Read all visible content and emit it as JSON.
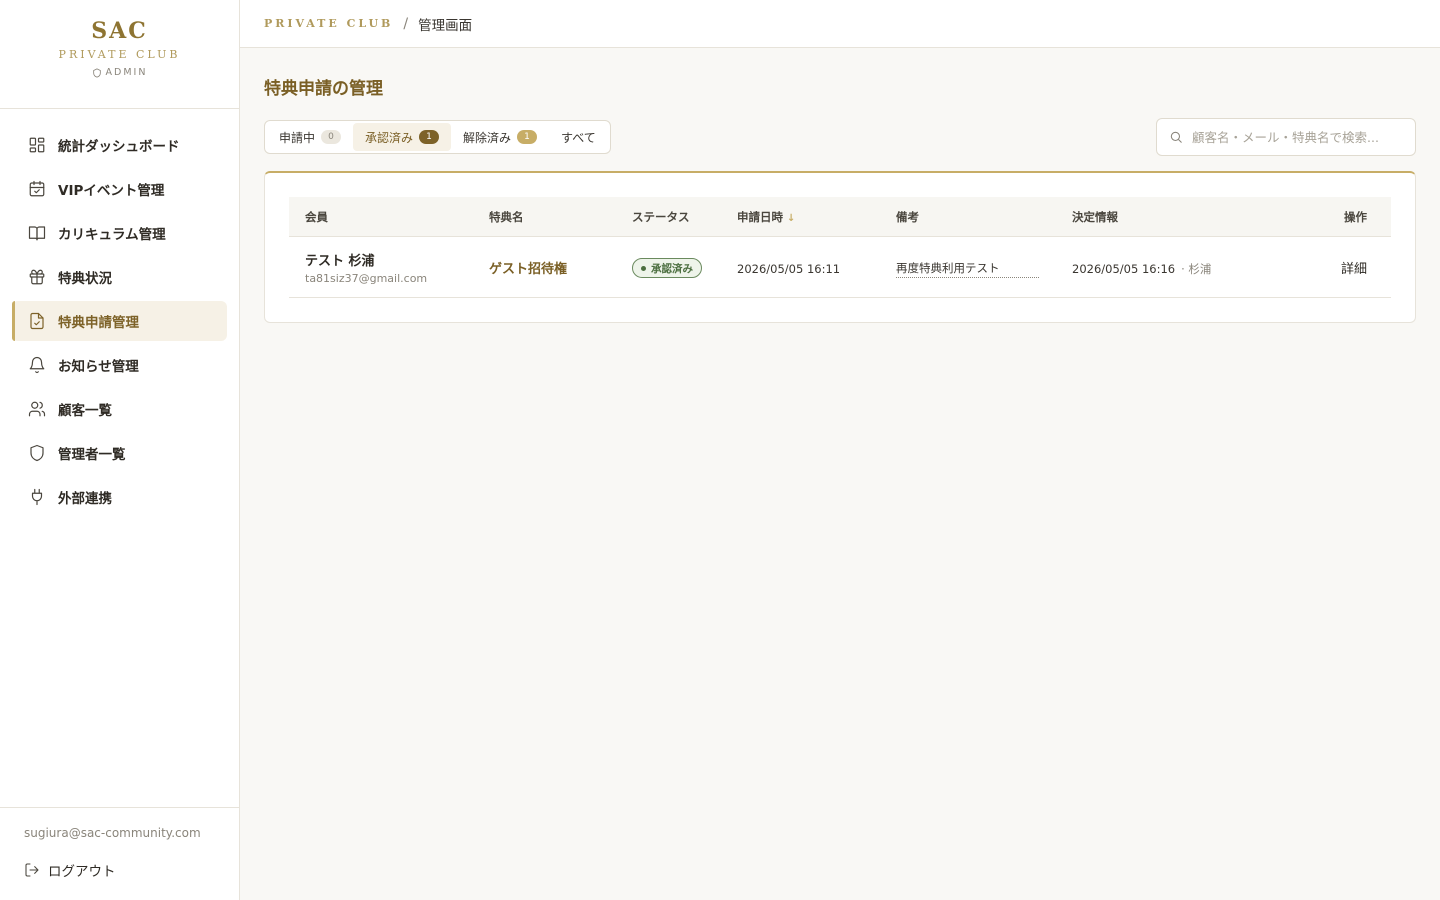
{
  "brand": {
    "name": "SAC",
    "sub": "PRIVATE CLUB",
    "role": "ADMIN"
  },
  "sidebar": {
    "items": [
      {
        "label": "統計ダッシュボード",
        "icon": "dashboard-icon"
      },
      {
        "label": "VIPイベント管理",
        "icon": "calendar-icon"
      },
      {
        "label": "カリキュラム管理",
        "icon": "book-icon"
      },
      {
        "label": "特典状況",
        "icon": "gift-icon"
      },
      {
        "label": "特典申請管理",
        "icon": "file-check-icon",
        "active": true
      },
      {
        "label": "お知らせ管理",
        "icon": "bell-icon"
      },
      {
        "label": "顧客一覧",
        "icon": "users-icon"
      },
      {
        "label": "管理者一覧",
        "icon": "shield-icon"
      },
      {
        "label": "外部連携",
        "icon": "plug-icon"
      }
    ],
    "user_email": "sugiura@sac-community.com",
    "logout_label": "ログアウト"
  },
  "header": {
    "club": "PRIVATE CLUB",
    "separator": "/",
    "page": "管理画面"
  },
  "main": {
    "title": "特典申請の管理",
    "tabs": [
      {
        "label": "申請中",
        "count": "0"
      },
      {
        "label": "承認済み",
        "count": "1",
        "active": true
      },
      {
        "label": "解除済み",
        "count": "1"
      },
      {
        "label": "すべて"
      }
    ],
    "search": {
      "placeholder": "顧客名・メール・特典名で検索..."
    },
    "table": {
      "columns": [
        "会員",
        "特典名",
        "ステータス",
        "申請日時",
        "備考",
        "決定情報",
        "操作"
      ],
      "sort_indicator": "↓",
      "rows": [
        {
          "member_name": "テスト 杉浦",
          "member_email": "ta81siz37@gmail.com",
          "benefit": "ゲスト招待権",
          "status": "承認済み",
          "applied_at": "2026/05/05 16:11",
          "note": "再度特典利用テスト",
          "decided_at": "2026/05/05 16:16",
          "decided_by": "· 杉浦",
          "action": "詳細"
        }
      ]
    }
  },
  "colors": {
    "accent": "#c7ad66",
    "accent_dark": "#7a5f25",
    "success": "#4c6f40"
  }
}
